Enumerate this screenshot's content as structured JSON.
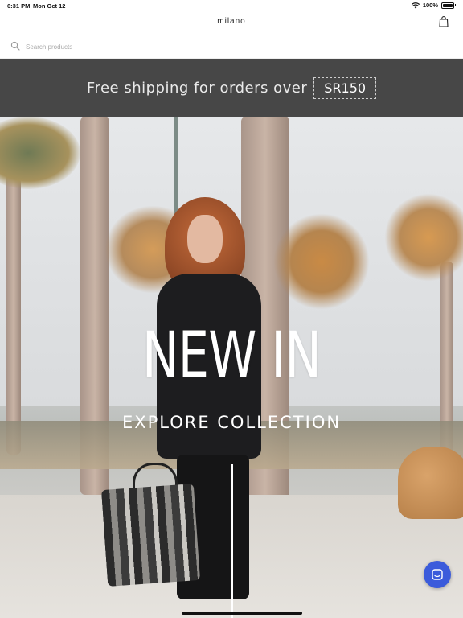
{
  "status_bar": {
    "time": "6:31 PM",
    "date": "Mon Oct 12",
    "battery": "100%",
    "icons": [
      "wifi-icon",
      "battery-icon"
    ]
  },
  "header": {
    "logo": "milano",
    "cart_icon": "shopping-bag-icon"
  },
  "search": {
    "placeholder": "Search products",
    "value": "",
    "icon": "search-icon"
  },
  "promo": {
    "text": "Free shipping for orders over",
    "code": "SR150",
    "background": "#474747"
  },
  "hero": {
    "title": "NEW IN",
    "subtitle": "EXPLORE COLLECTION"
  },
  "chat": {
    "icon": "chat-icon",
    "color": "#3b5bdb"
  }
}
